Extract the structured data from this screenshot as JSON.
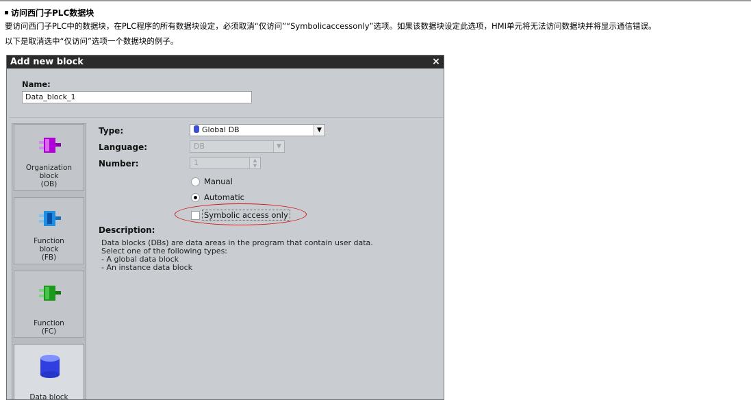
{
  "document": {
    "title": "访问西门子PLC数据块",
    "line1": "要访问西门子PLC中的数据块，在PLC程序的所有数据块设定，必须取消“仅访问”“Symbolicaccessonly”选项。如果该数据块设定此选项，HMI单元将无法访问数据块并将显示通信错误。",
    "line2": "以下是取消选中“仅访问”选项一个数据块的例子。"
  },
  "dialog": {
    "title": "Add new block",
    "close_label": "×",
    "name_label": "Name:",
    "name_value": "Data_block_1",
    "blocks": [
      {
        "label": "Organization\nblock\n(OB)",
        "icon": "organization-block-icon",
        "color": "#b000d8"
      },
      {
        "label": "Function\nblock\n(FB)",
        "icon": "function-block-icon",
        "color": "#1e8fe0"
      },
      {
        "label": "Function\n(FC)",
        "icon": "function-icon",
        "color": "#1a9a1a"
      },
      {
        "label": "Data block",
        "icon": "data-block-icon",
        "color": "#2f3fe0"
      }
    ],
    "type_label": "Type:",
    "type_value": "Global DB",
    "language_label": "Language:",
    "language_value": "DB",
    "number_label": "Number:",
    "number_value": "1",
    "manual_label": "Manual",
    "automatic_label": "Automatic",
    "symbolic_label": "Symbolic access only",
    "description_title": "Description:",
    "description_text": "Data blocks (DBs) are data areas in the program that contain user data.\nSelect one of the following types:\n- A global data block\n- An instance data block"
  },
  "colors": {
    "titlebar": "#2b2b2b",
    "dialog_bg": "#c9cdd1",
    "highlight": "#d01515"
  }
}
